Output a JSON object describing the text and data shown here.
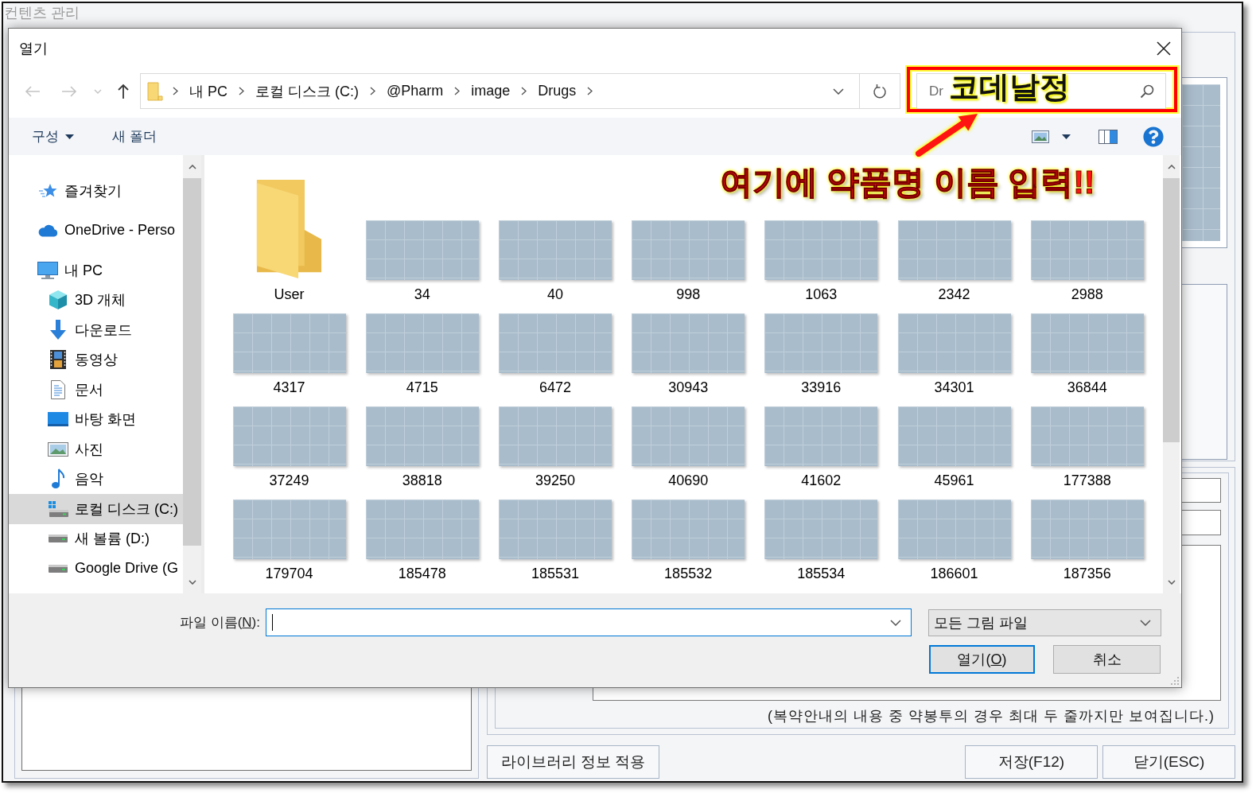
{
  "app_window": {
    "title": "컨텐츠 관리",
    "note": "(복약안내의 내용 중 약봉투의 경우 최대 두 줄까지만 보여집니다.)",
    "buttons": [
      "라이브러리 정보 적용",
      "저장(F12)",
      "닫기(ESC)"
    ]
  },
  "dialog": {
    "title": "열기",
    "history": [
      {
        "kind": "back",
        "disabled": true
      },
      {
        "kind": "forward",
        "disabled": true
      },
      {
        "kind": "recent",
        "disabled": true
      },
      {
        "kind": "up",
        "disabled": false
      }
    ],
    "address": [
      "내 PC",
      "로컬 디스크 (C:)",
      "@Pharm",
      "image",
      "Drugs"
    ],
    "search": {
      "placeholder": "Dr"
    },
    "toolbar": {
      "organize": "구성",
      "new_folder": "새 폴더"
    },
    "nav": [
      {
        "label": "즐겨찾기",
        "kind": "favorites",
        "selected": false
      },
      {
        "label": "OneDrive - Perso",
        "kind": "cloud",
        "selected": false
      },
      {
        "label": "내 PC",
        "kind": "pc",
        "selected": false,
        "children": [
          {
            "label": "3D 개체",
            "kind": "objects",
            "selected": false
          },
          {
            "label": "다운로드",
            "kind": "downloads",
            "selected": false
          },
          {
            "label": "동영상",
            "kind": "videos",
            "selected": false
          },
          {
            "label": "문서",
            "kind": "documents",
            "selected": false
          },
          {
            "label": "바탕 화면",
            "kind": "desktop",
            "selected": false
          },
          {
            "label": "사진",
            "kind": "pictures",
            "selected": false
          },
          {
            "label": "음악",
            "kind": "music",
            "selected": false
          },
          {
            "label": "로컬 디스크 (C:)",
            "kind": "system-drive",
            "selected": true
          },
          {
            "label": "새 볼륨 (D:)",
            "kind": "drive",
            "selected": false
          },
          {
            "label": "Google Drive (G",
            "kind": "drive",
            "selected": false
          }
        ]
      }
    ],
    "files": [
      {
        "name": "User",
        "kind": "folder",
        "selected": false
      },
      {
        "name": "34",
        "kind": "image",
        "selected": false
      },
      {
        "name": "40",
        "kind": "image",
        "selected": false
      },
      {
        "name": "998",
        "kind": "image",
        "selected": false
      },
      {
        "name": "1063",
        "kind": "image",
        "selected": false
      },
      {
        "name": "2342",
        "kind": "image",
        "selected": false
      },
      {
        "name": "2988",
        "kind": "image",
        "selected": false
      },
      {
        "name": "4317",
        "kind": "image",
        "selected": false
      },
      {
        "name": "4715",
        "kind": "image",
        "selected": false
      },
      {
        "name": "6472",
        "kind": "image",
        "selected": false
      },
      {
        "name": "30943",
        "kind": "image",
        "selected": false
      },
      {
        "name": "33916",
        "kind": "image",
        "selected": false
      },
      {
        "name": "34301",
        "kind": "image",
        "selected": false
      },
      {
        "name": "36844",
        "kind": "image",
        "selected": false
      },
      {
        "name": "37249",
        "kind": "image",
        "selected": false
      },
      {
        "name": "38818",
        "kind": "image",
        "selected": false
      },
      {
        "name": "39250",
        "kind": "image",
        "selected": false
      },
      {
        "name": "40690",
        "kind": "image",
        "selected": false
      },
      {
        "name": "41602",
        "kind": "image",
        "selected": false
      },
      {
        "name": "45961",
        "kind": "image",
        "selected": false
      },
      {
        "name": "177388",
        "kind": "image",
        "selected": false
      },
      {
        "name": "179704",
        "kind": "image",
        "selected": false
      },
      {
        "name": "185478",
        "kind": "image",
        "selected": false
      },
      {
        "name": "185531",
        "kind": "image",
        "selected": false
      },
      {
        "name": "185532",
        "kind": "image",
        "selected": false
      },
      {
        "name": "185534",
        "kind": "image",
        "selected": false
      },
      {
        "name": "186601",
        "kind": "image",
        "selected": false
      },
      {
        "name": "187356",
        "kind": "image",
        "selected": false
      }
    ],
    "file_name": {
      "label": {
        "before": "파일 이름(",
        "key": "N",
        "after": "):"
      },
      "focused": true
    },
    "file_type": {
      "value": "모든 그림 파일"
    },
    "open_button": {
      "label": {
        "before": "열기(",
        "key": "O",
        "after": ")"
      },
      "default": true
    },
    "cancel_button": {
      "label": "취소",
      "default": false
    }
  },
  "annotation": {
    "typed_text": "코데날정",
    "note": "여기에 약품명 이름 입력!!"
  }
}
